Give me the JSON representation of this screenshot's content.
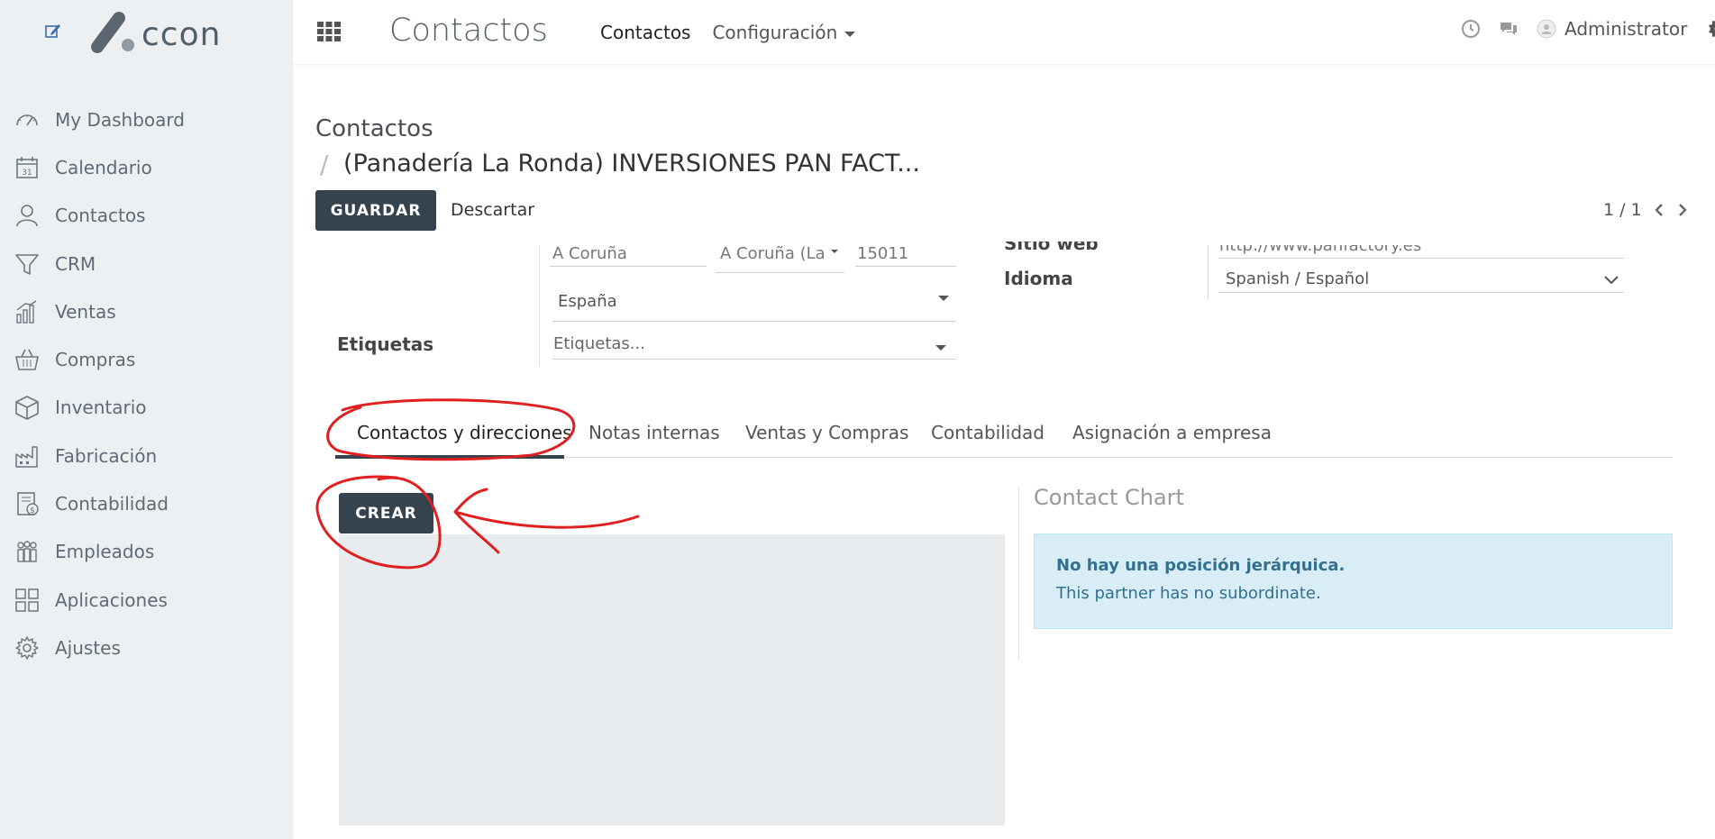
{
  "brand": {
    "logo_text": "ccon"
  },
  "sidebar": {
    "items": [
      {
        "label": "My Dashboard",
        "icon": "gauge-icon"
      },
      {
        "label": "Calendario",
        "icon": "calendar-icon"
      },
      {
        "label": "Contactos",
        "icon": "user-icon"
      },
      {
        "label": "CRM",
        "icon": "funnel-icon"
      },
      {
        "label": "Ventas",
        "icon": "bar-chart-icon"
      },
      {
        "label": "Compras",
        "icon": "basket-icon"
      },
      {
        "label": "Inventario",
        "icon": "box-icon"
      },
      {
        "label": "Fabricación",
        "icon": "factory-icon"
      },
      {
        "label": "Contabilidad",
        "icon": "invoice-icon"
      },
      {
        "label": "Empleados",
        "icon": "people-icon"
      },
      {
        "label": "Aplicaciones",
        "icon": "grid-icon"
      },
      {
        "label": "Ajustes",
        "icon": "gear-icon"
      }
    ]
  },
  "topbar": {
    "app_title": "Contactos",
    "nav": {
      "contacts": "Contactos",
      "config": "Configuración"
    },
    "user": "Administrator"
  },
  "breadcrumb": {
    "parent": "Contactos",
    "separator": "/",
    "current": "(Panadería La Ronda) INVERSIONES PAN FACT..."
  },
  "actions": {
    "save": "GUARDAR",
    "discard": "Descartar"
  },
  "pager": {
    "text": "1 / 1"
  },
  "form": {
    "city": "A Coruña",
    "state": "A Coruña (La C",
    "zip": "15011",
    "country": "España",
    "tags_label": "Etiquetas",
    "tags_placeholder": "Etiquetas...",
    "website_label": "Sitio web",
    "website_value": "http://www.panfactory.es",
    "language_label": "Idioma",
    "language_value": "Spanish / Español"
  },
  "tabs": [
    "Contactos y direcciones",
    "Notas internas",
    "Ventas y Compras",
    "Contabilidad",
    "Asignación a empresa"
  ],
  "create_button": "CREAR",
  "contact_chart": {
    "title": "Contact Chart",
    "alert_title": "No hay una posición jerárquica.",
    "alert_text": "This partner has no subordinate."
  },
  "colors": {
    "primary_button": "#35434e",
    "sidebar_bg": "#edf0f3",
    "alert_bg": "#d9edf7",
    "alert_text": "#31708f",
    "annotation": "#e02020"
  }
}
